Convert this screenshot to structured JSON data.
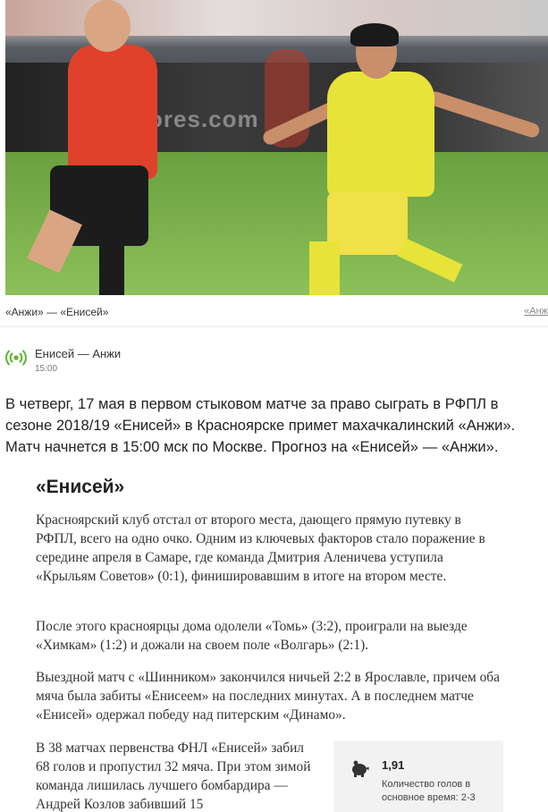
{
  "photo": {
    "alt_text": "",
    "board_text": "ores.com"
  },
  "caption": {
    "text": "«Анжи» — «Енисей»",
    "link": "«Анж"
  },
  "match": {
    "title": "Енисей — Анжи",
    "time": "15:00"
  },
  "lead": "В четверг, 17 мая в первом стыковом матче за право сыграть в РФПЛ в сезоне 2018/19 «Енисей» в Красноярске примет махачкалинский «Анжи». Матч начнется в 15:00 мск по Москве. Прогноз на «Енисей» — «Анжи».",
  "section": {
    "title": "«Енисей»"
  },
  "paragraphs": [
    "Красноярский клуб отстал от второго места, дающего прямую путевку в РФПЛ, всего на одно очко. Одним из ключевых факторов стало поражение в середине апреля в Самаре, где команда Дмитрия Аленичева уступила «Крыльям Советов» (0:1), финишировавшим в итоге на втором месте.",
    "После этого красноярцы дома одолели «Томь» (3:2), проиграли на выезде «Химкам» (1:2) и дожали на своем поле «Волгарь» (2:1).",
    "Выездной матч с «Шинником» закончился ничьей 2:2 в Ярославле, причем оба мяча была забиты «Енисеем» на последних минутах. А в последнем матче «Енисей» одержал победу над питерским «Динамо».",
    "В 38 матчах первенства ФНЛ «Енисей» забил 68 голов и пропустил 32 мяча. При этом зимой команда лишилась лучшего бомбардира — Андрей Козлов забивший 15"
  ],
  "stat": {
    "value": "1,91",
    "label": "Количество голов в основное время: 2-3",
    "icon": "piggy-bank-icon"
  },
  "colors": {
    "accent_green": "#5cb531",
    "stat_bg": "#f2f2f2"
  }
}
